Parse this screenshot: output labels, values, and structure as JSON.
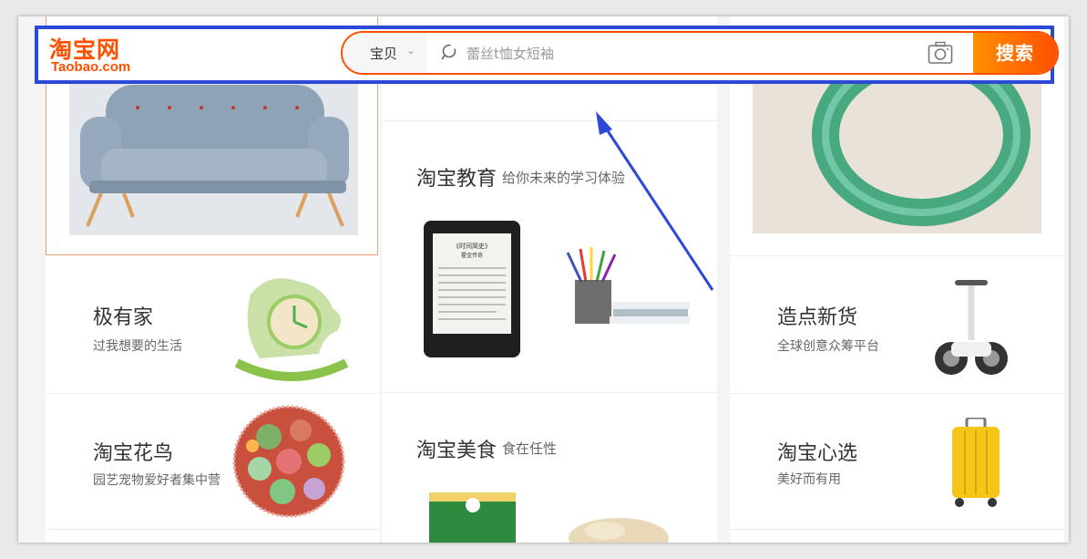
{
  "logo": {
    "cn": "淘宝网",
    "en": "Taobao.com"
  },
  "search": {
    "scope_label": "宝贝",
    "placeholder": "蕾丝t恤女短袖",
    "button_label": "搜索"
  },
  "cards": {
    "education": {
      "title": "淘宝教育",
      "subtitle": "给你未来的学习体验"
    },
    "jiyoujia": {
      "title": "极有家",
      "subtitle": "过我想要的生活"
    },
    "zaodian": {
      "title": "造点新货",
      "subtitle": "全球创意众筹平台"
    },
    "huaniao": {
      "title": "淘宝花鸟",
      "subtitle": "园艺宠物爱好者集中营"
    },
    "food": {
      "title": "淘宝美食",
      "subtitle": "食在任性"
    },
    "xinxuan": {
      "title": "淘宝心选",
      "subtitle": "美好而有用"
    }
  },
  "ebook_text": {
    "title": "《时间简史》",
    "subtitle": "霍金传奇"
  },
  "colors": {
    "brand": "#ff5000",
    "highlight": "#2b48d6"
  }
}
